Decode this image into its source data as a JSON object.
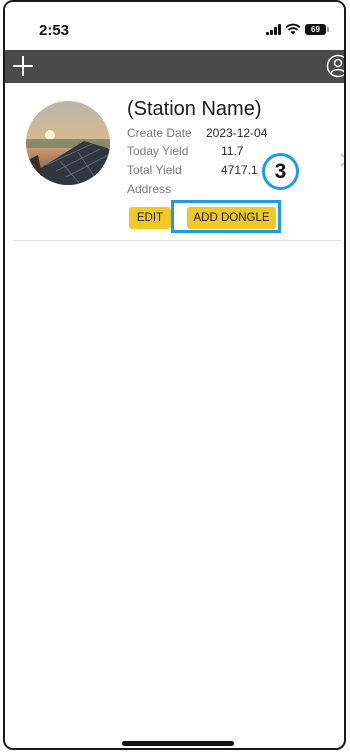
{
  "status_bar": {
    "time": "2:53",
    "battery_level": "69"
  },
  "nav_bar": {
    "add_icon": "plus-icon",
    "user_icon": "user-circle-icon"
  },
  "station": {
    "name": "(Station Name)",
    "create_date_label": "Create Date",
    "create_date_value": "2023-12-04",
    "today_yield_label": "Today Yield",
    "today_yield_value": "11.7",
    "total_yield_label": "Total Yield",
    "total_yield_value": "4717.1",
    "address_label": "Address",
    "edit_label": "EDIT",
    "add_dongle_label": "ADD DONGLE"
  },
  "annotation": {
    "step_number": "3",
    "highlight_color": "#1e9be2"
  },
  "colors": {
    "nav_bar": "#4a4a4a",
    "button": "#f0c929"
  }
}
